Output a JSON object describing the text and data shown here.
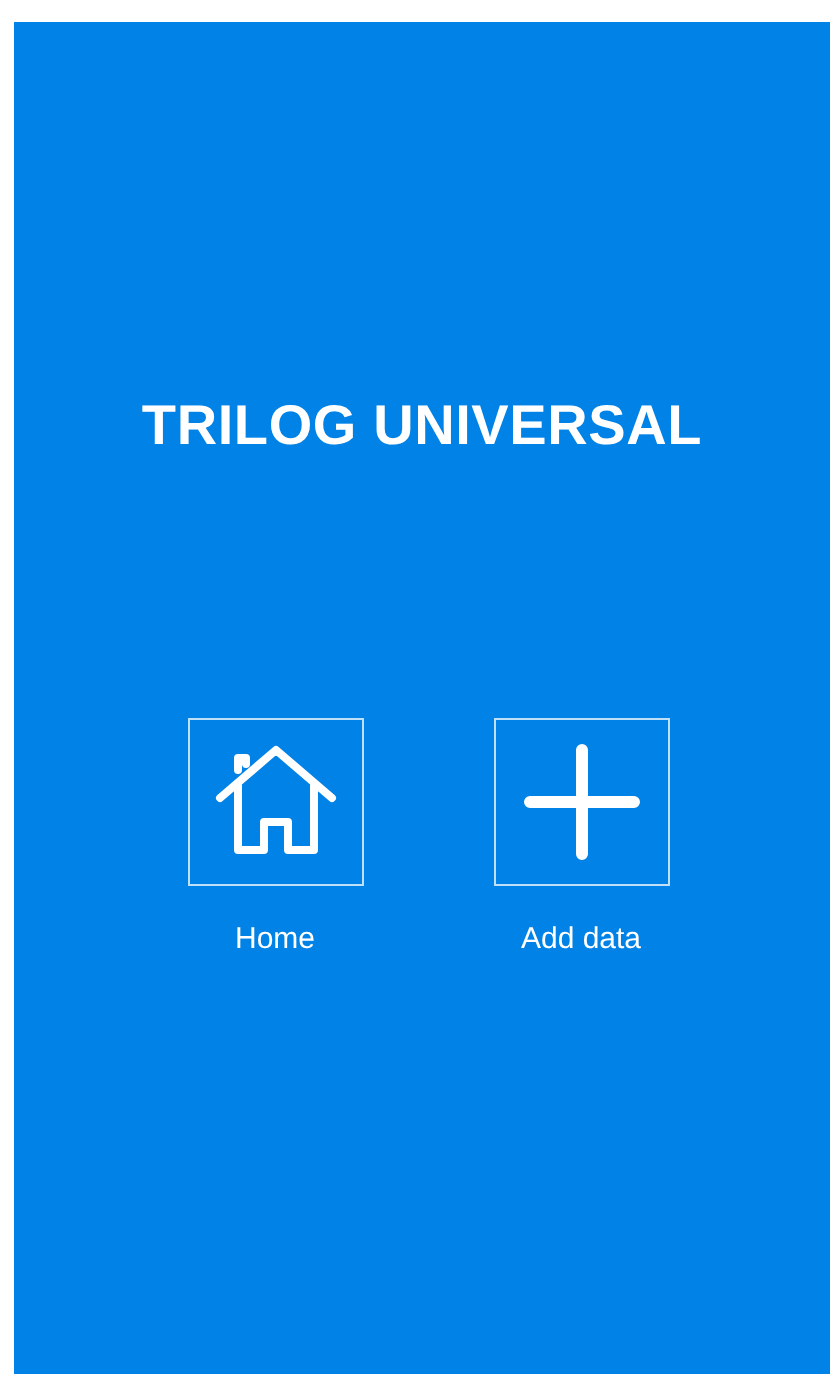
{
  "title": "TRILOG UNIVERSAL",
  "actions": [
    {
      "kind": "home",
      "label": "Home"
    },
    {
      "kind": "add",
      "label": "Add data"
    }
  ]
}
